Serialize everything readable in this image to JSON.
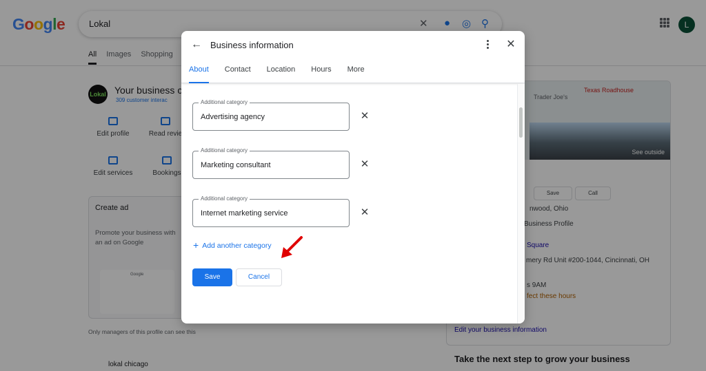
{
  "search": {
    "query": "Lokal"
  },
  "tabs": [
    "All",
    "Images",
    "Shopping"
  ],
  "account": {
    "initial": "L"
  },
  "business": {
    "logo_text": "Lokal",
    "title": "Your business c",
    "interactions": "309 customer interac"
  },
  "actions": [
    "Edit profile",
    "Read revie",
    "Edit services",
    "Bookings"
  ],
  "ad_card": {
    "title": "Create ad",
    "body": "Promote your business with an ad on Google",
    "mock_label": "Google"
  },
  "managers_note": "Only managers of this profile can see this",
  "bottom_result": "lokal chicago",
  "right_panel": {
    "map_labels": [
      "Trader Joe's",
      "Texas Roadhouse"
    ],
    "see_outside": "See outside",
    "buttons": [
      "Save",
      "Call"
    ],
    "location_text": "nwood, Ohio",
    "profile_text": "Business Profile",
    "link_square": "Square",
    "address": "mery Rd Unit #200-1044, Cincinnati, OH",
    "hours": "s 9AM",
    "hours_warning": "fect these hours",
    "edit_link": "Edit your business information",
    "grow_heading": "Take the next step to grow your business"
  },
  "modal": {
    "title": "Business information",
    "tabs": [
      {
        "label": "About",
        "active": true
      },
      {
        "label": "Contact"
      },
      {
        "label": "Location"
      },
      {
        "label": "Hours"
      },
      {
        "label": "More"
      }
    ],
    "fields": [
      {
        "label": "Additional category",
        "value": "Advertising agency"
      },
      {
        "label": "Additional category",
        "value": "Marketing consultant"
      },
      {
        "label": "Additional category",
        "value": "Internet marketing service"
      }
    ],
    "add_category": "Add another category",
    "save_label": "Save",
    "cancel_label": "Cancel"
  },
  "colors": {
    "accent": "#1a73e8",
    "annotation_arrow": "#e00000"
  }
}
